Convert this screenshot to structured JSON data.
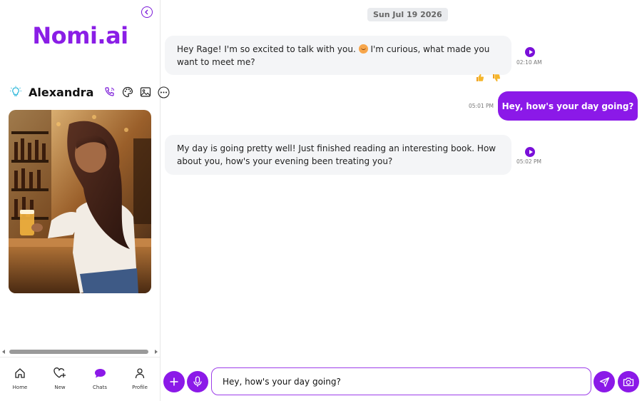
{
  "app": {
    "logo": "Nomi.ai"
  },
  "profile": {
    "name": "Alexandra"
  },
  "nav": [
    {
      "label": "Home"
    },
    {
      "label": "New"
    },
    {
      "label": "Chats"
    },
    {
      "label": "Profile"
    }
  ],
  "chat": {
    "date": "Sun Jul 19 2026",
    "messages": [
      {
        "sender": "ai",
        "line1": "Hey Rage! I'm so excited to talk with you.",
        "line1b": "I'm curious, what made you",
        "line2": "want to meet me?",
        "time": "02:10 AM"
      },
      {
        "sender": "user",
        "text": "Hey, how's your day going?",
        "time": "05:01 PM"
      },
      {
        "sender": "ai",
        "line1": "My day is going pretty well! Just finished reading an interesting book. How",
        "line2": "about you, how's your evening been treating you?",
        "time": "05:02 PM"
      }
    ]
  },
  "composer": {
    "value": "Hey, how's your day going?"
  },
  "colors": {
    "accent": "#8b19e8",
    "bubble_ai": "#f4f5f7"
  }
}
